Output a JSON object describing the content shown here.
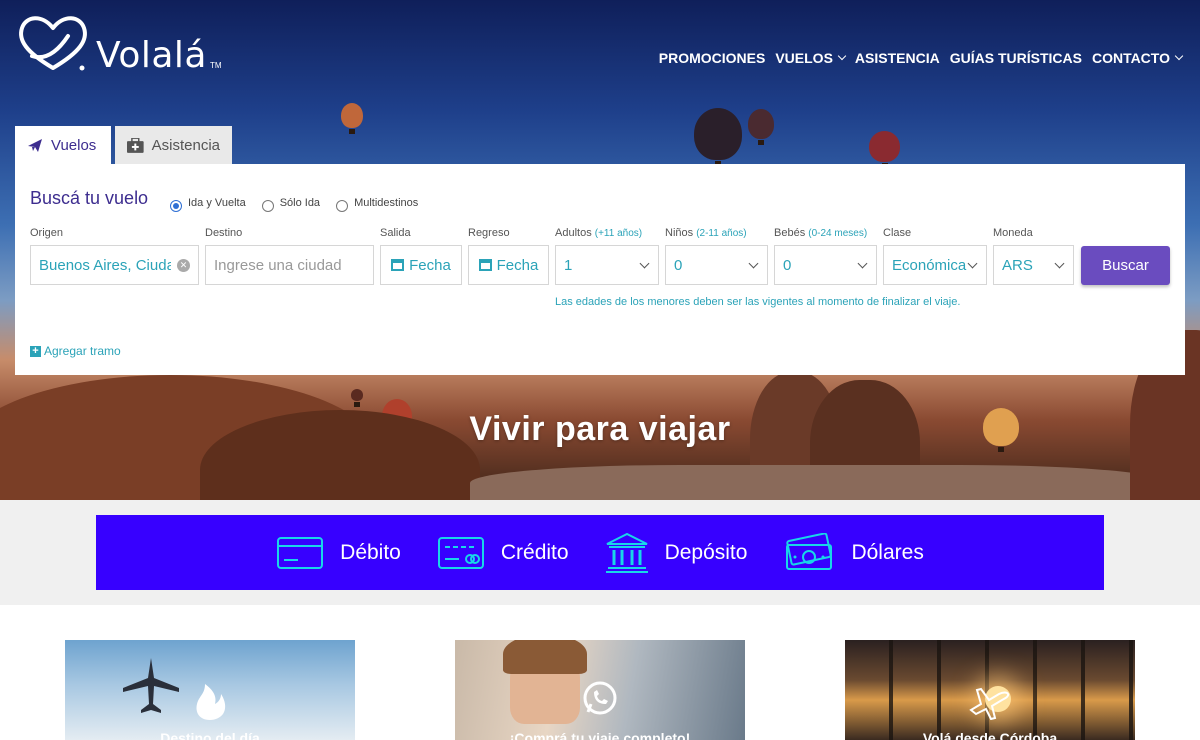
{
  "brand": {
    "name": "Volalá",
    "tm": "TM"
  },
  "nav": {
    "items": [
      {
        "label": "PROMOCIONES",
        "has_dropdown": false
      },
      {
        "label": "VUELOS",
        "has_dropdown": true
      },
      {
        "label": "ASISTENCIA",
        "has_dropdown": false
      },
      {
        "label": "GUÍAS TURÍSTICAS",
        "has_dropdown": false
      },
      {
        "label": "CONTACTO",
        "has_dropdown": true
      }
    ]
  },
  "tabs": [
    {
      "label": "Vuelos",
      "active": true,
      "icon": "plane-icon"
    },
    {
      "label": "Asistencia",
      "active": false,
      "icon": "medical-kit-icon"
    }
  ],
  "search": {
    "title": "Buscá tu vuelo",
    "trip_types": [
      {
        "label": "Ida y Vuelta",
        "checked": true
      },
      {
        "label": "Sólo Ida",
        "checked": false
      },
      {
        "label": "Multidestinos",
        "checked": false
      }
    ],
    "origin": {
      "label": "Origen",
      "value": "Buenos Aires, Ciudad"
    },
    "destination": {
      "label": "Destino",
      "placeholder": "Ingrese una ciudad"
    },
    "departure": {
      "label": "Salida",
      "value": "Fecha"
    },
    "return": {
      "label": "Regreso",
      "value": "Fecha"
    },
    "adults": {
      "label": "Adultos",
      "hint": "(+11 años)",
      "value": "1"
    },
    "children": {
      "label": "Niños",
      "hint": "(2-11 años)",
      "value": "0"
    },
    "infants": {
      "label": "Bebés",
      "hint": "(0-24 meses)",
      "value": "0"
    },
    "class": {
      "label": "Clase",
      "value": "Económica"
    },
    "currency": {
      "label": "Moneda",
      "value": "ARS"
    },
    "button": "Buscar",
    "age_note": "Las edades de los menores deben ser las vigentes al momento de finalizar el viaje.",
    "add_leg": "Agregar tramo"
  },
  "hero": {
    "slogan": "Vivir para viajar"
  },
  "payments": [
    {
      "label": "Débito",
      "icon": "debit-card-icon"
    },
    {
      "label": "Crédito",
      "icon": "credit-card-icon"
    },
    {
      "label": "Depósito",
      "icon": "bank-icon"
    },
    {
      "label": "Dólares",
      "icon": "money-icon"
    }
  ],
  "cards": [
    {
      "title": "Destino del día",
      "icon": "flame-icon"
    },
    {
      "title": "¡Comprá tu viaje completo!",
      "icon": "whatsapp-icon"
    },
    {
      "title": "Volá desde Córdoba",
      "icon": "plane-icon"
    }
  ],
  "colors": {
    "brand_purple": "#3d2d8f",
    "accent_teal": "#2ba3b8",
    "button": "#6a4cbf",
    "pay_blue": "#3700ff",
    "pay_icon": "#18d6e8"
  }
}
